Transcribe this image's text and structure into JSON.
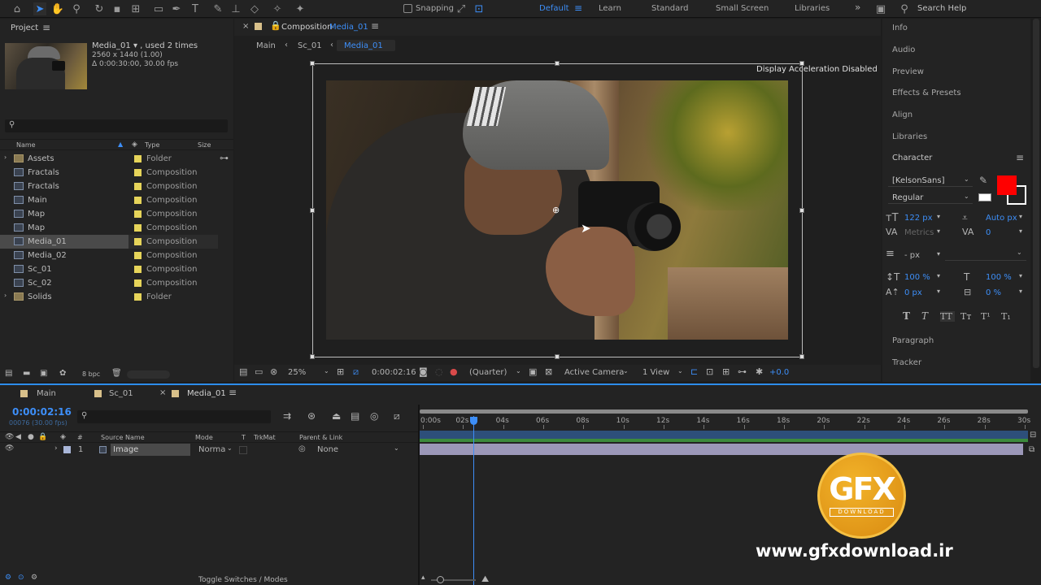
{
  "toolbar": {
    "snapping_label": "Snapping",
    "workspaces": [
      "Default",
      "Learn",
      "Standard",
      "Small Screen",
      "Libraries"
    ],
    "active_workspace": "Default",
    "search_placeholder": "Search Help",
    "expand_glyph": "»"
  },
  "project": {
    "title": "Project",
    "footage_name": "Media_01 ▾ , used 2 times",
    "footage_dims": "2560 x 1440 (1.00)",
    "footage_duration": "Δ 0:00:30:00, 30.00 fps",
    "columns": {
      "name": "Name",
      "type": "Type",
      "size": "Size"
    },
    "items": [
      {
        "name": "Assets",
        "type": "Folder",
        "kind": "folder",
        "color": "#e6d45a"
      },
      {
        "name": "Fractals",
        "type": "Composition",
        "kind": "comp",
        "color": "#e6d45a"
      },
      {
        "name": "Fractals",
        "type": "Composition",
        "kind": "comp",
        "color": "#e6d45a"
      },
      {
        "name": "Main",
        "type": "Composition",
        "kind": "comp",
        "color": "#e6d45a"
      },
      {
        "name": "Map",
        "type": "Composition",
        "kind": "comp",
        "color": "#e6d45a"
      },
      {
        "name": "Map",
        "type": "Composition",
        "kind": "comp",
        "color": "#e6d45a"
      },
      {
        "name": "Media_01",
        "type": "Composition",
        "kind": "comp",
        "color": "#e6d45a",
        "selected": true
      },
      {
        "name": "Media_02",
        "type": "Composition",
        "kind": "comp",
        "color": "#e6d45a"
      },
      {
        "name": "Sc_01",
        "type": "Composition",
        "kind": "comp",
        "color": "#e6d45a"
      },
      {
        "name": "Sc_02",
        "type": "Composition",
        "kind": "comp",
        "color": "#e6d45a"
      },
      {
        "name": "Solids",
        "type": "Folder",
        "kind": "folder",
        "color": "#e6d45a"
      }
    ],
    "bpc": "8 bpc"
  },
  "composition": {
    "tab_prefix": "Composition",
    "tab_name": "Media_01",
    "breadcrumbs": [
      "Main",
      "Sc_01",
      "Media_01"
    ],
    "notice": "Display Acceleration Disabled",
    "zoom": "25%",
    "timecode": "0:00:02:16",
    "resolution": "(Quarter)",
    "camera": "Active Camera",
    "views": "1 View",
    "exposure": "+0.0"
  },
  "right_panel": {
    "items_top": [
      "Info",
      "Audio",
      "Preview",
      "Effects & Presets",
      "Align",
      "Libraries"
    ],
    "character_title": "Character",
    "font": "[KelsonSans]",
    "style": "Regular",
    "font_size": "122 px",
    "leading": "Auto px",
    "kerning": "Metrics",
    "tracking": "0",
    "stroke": "- px",
    "vscale": "100 %",
    "hscale": "100 %",
    "baseline": "0 px",
    "tsume": "0 %",
    "fill_color": "#ff0000",
    "type_buttons": [
      "T",
      "T",
      "TT",
      "Tт",
      "T¹",
      "T₁"
    ],
    "items_bottom": [
      "Paragraph",
      "Tracker"
    ]
  },
  "timeline": {
    "tabs": [
      "Main",
      "Sc_01",
      "Media_01"
    ],
    "timecode": "0:00:02:16",
    "frames": "00076 (30.00 fps)",
    "columns": {
      "source": "Source Name",
      "mode": "Mode",
      "t": "T",
      "trkmat": "TrkMat",
      "parent": "Parent & Link"
    },
    "layer": {
      "index": "1",
      "name": "Image",
      "mode": "Norma",
      "parent": "None"
    },
    "ruler": [
      "0:00s",
      "02s",
      "04s",
      "06s",
      "08s",
      "10s",
      "12s",
      "14s",
      "16s",
      "18s",
      "20s",
      "22s",
      "24s",
      "26s",
      "28s",
      "30s"
    ],
    "playhead_seconds": 2.53,
    "duration_seconds": 30,
    "toggle_label": "Toggle Switches / Modes"
  },
  "watermark": {
    "logo_text": "GFX",
    "logo_sub": "DOWNLOAD",
    "url": "www.gfxdownload.ir"
  }
}
